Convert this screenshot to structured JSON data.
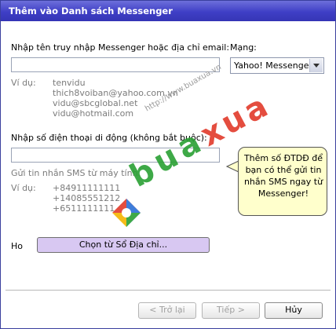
{
  "window": {
    "title": "Thêm vào Danh sách Messenger"
  },
  "form": {
    "username_label": "Nhập tên truy nhập Messenger hoặc địa chỉ email:",
    "username_value": "",
    "network_label": "Mạng:",
    "network_value": "Yahoo! Messenger",
    "example_label": "Ví dụ:",
    "examples": [
      "tenvidu",
      "thich8voiban@yahoo.com.vn",
      "vidu@sbcglobal.net",
      "vidu@hotmail.com"
    ],
    "phone_label": "Nhập số điện thoại di động (không bắt buộc):",
    "phone_value": "",
    "sms_hint": "Gửi tin nhắn SMS từ máy tính.",
    "phone_example_label": "Ví dụ:",
    "phone_examples": [
      "+84911111111",
      "+14085551212",
      "+6511111111"
    ],
    "other_label": "Ho",
    "address_book_button": "Chọn từ Sổ Địa chỉ..."
  },
  "tooltip": {
    "text": "Thêm số ĐTDĐ để bạn có thể gửi tin nhắn SMS ngay từ Messenger!"
  },
  "watermark": {
    "url": "http://www.buaxua.vn",
    "brand": "buaxua"
  },
  "footer": {
    "back_button": "< Trở lại",
    "next_button": "Tiếp >",
    "cancel_button": "Hủy"
  },
  "colors": {
    "title_bar": "#3f3fc6",
    "tooltip_bg": "#ffffcc",
    "button_highlight": "#d8c8f2",
    "watermark_green": "#2aa034"
  }
}
